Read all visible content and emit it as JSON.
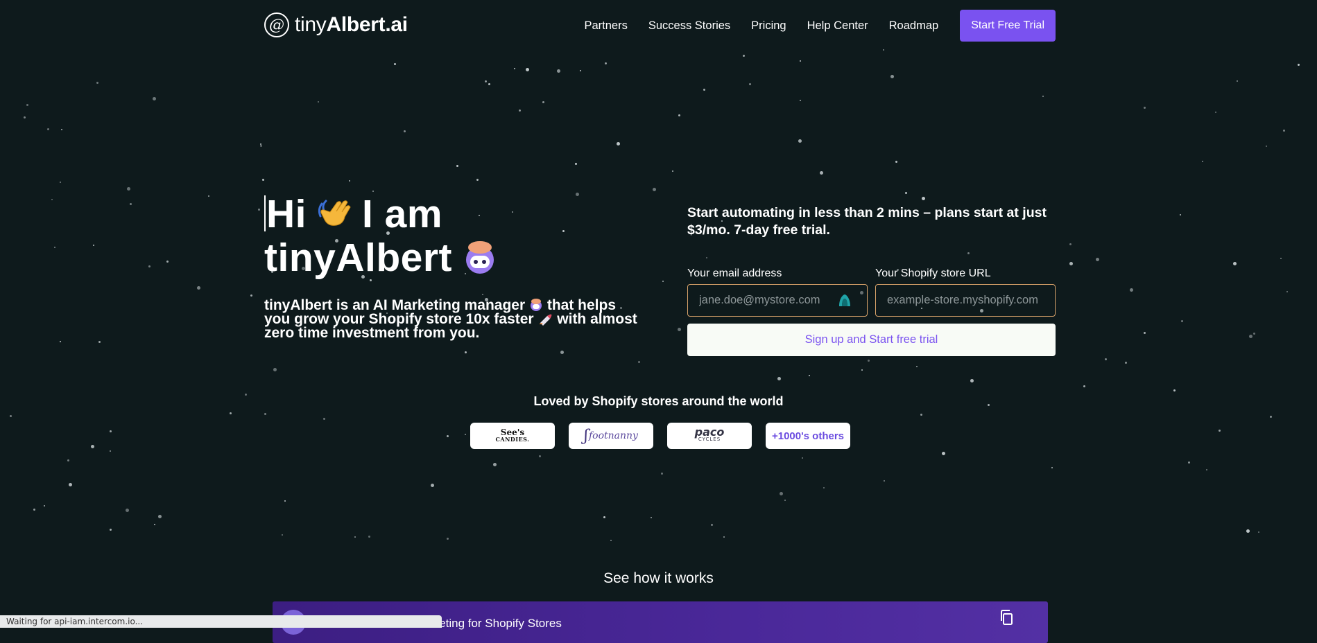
{
  "header": {
    "logo_symbol": "@",
    "logo_text_light": "tiny",
    "logo_text_bold": "Albert.ai",
    "nav": [
      {
        "label": "Partners"
      },
      {
        "label": "Success Stories"
      },
      {
        "label": "Pricing"
      },
      {
        "label": "Help Center"
      },
      {
        "label": "Roadmap"
      }
    ],
    "cta_label": "Start Free Trial",
    "cta_color": "#7a52f0"
  },
  "hero": {
    "line1_a": "Hi",
    "line1_b": "I am",
    "line2": "tinyAlbert",
    "sub_a": "tinyAlbert is an AI Marketing manager",
    "sub_b": " that helps you grow your Shopify store 10x faster ",
    "sub_c": " with almost zero time investment from you.",
    "icons": [
      "waving-hand-icon",
      "robot-mascot-icon",
      "rocket-icon"
    ]
  },
  "signup": {
    "lead": "Start automating in less than 2 mins – plans start at just $3/mo. 7-day free trial.",
    "email_label": "Your email address",
    "email_placeholder": "jane.doe@mystore.com",
    "store_label": "Your Shopify store URL",
    "store_placeholder": "example-store.myshopify.com",
    "submit_label": "Sign up and Start free trial",
    "accent_color": "#7a52f0",
    "border_color": "#d9a36a"
  },
  "social": {
    "heading": "Loved by Shopify stores around the world",
    "logos": [
      {
        "line1": "See's",
        "line2": "CANDIES."
      },
      {
        "text": "footnanny"
      },
      {
        "line1": "paco",
        "line2": "CYCLES"
      }
    ],
    "more_label": "+1000's others"
  },
  "how": {
    "heading": "See how it works",
    "video_title": "rketing for Shopify Stores"
  },
  "statusbar": {
    "text": "Waiting for api-iam.intercom.io..."
  }
}
